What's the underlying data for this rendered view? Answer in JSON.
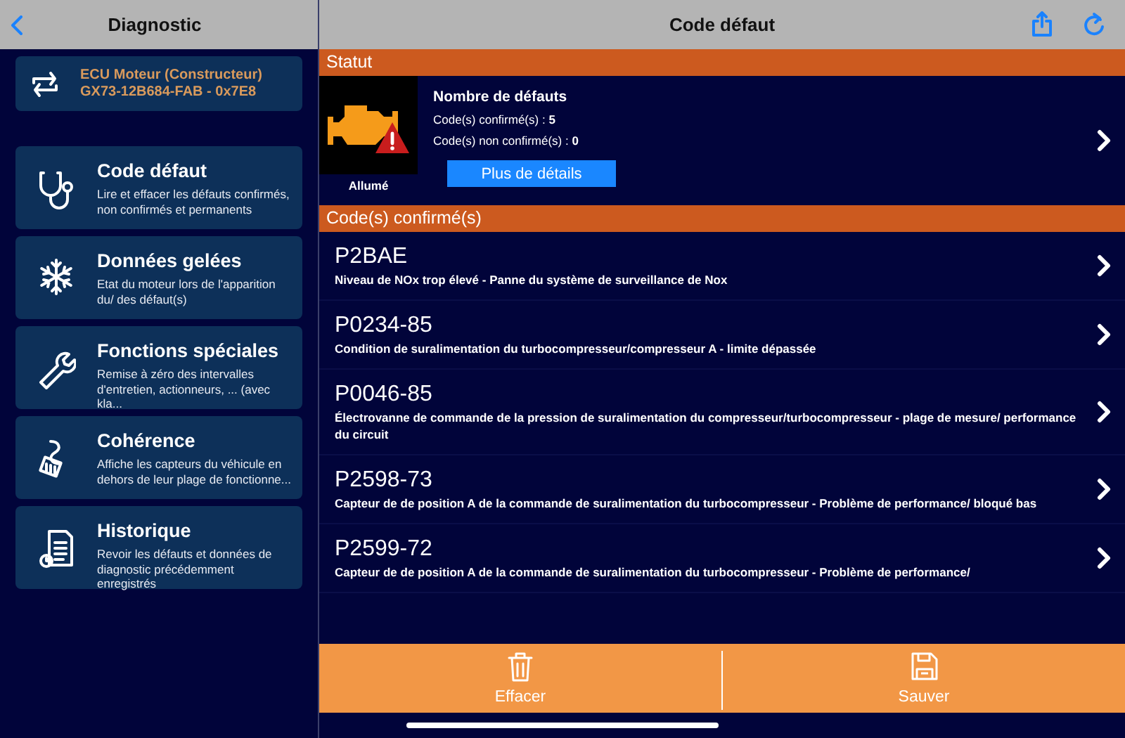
{
  "sidebar": {
    "title": "Diagnostic",
    "ecu": {
      "name": "ECU Moteur (Constructeur)",
      "reference": "GX73-12B684-FAB - 0x7E8"
    },
    "menu": [
      {
        "title": "Code défaut",
        "description": "Lire et effacer les défauts confirmés, non confirmés et permanents"
      },
      {
        "title": "Données gelées",
        "description": "Etat du moteur lors de l'apparition du/ des défaut(s)"
      },
      {
        "title": "Fonctions spéciales",
        "description": "Remise à zéro des intervalles d'entretien, actionneurs, ... (avec kla..."
      },
      {
        "title": "Cohérence",
        "description": "Affiche les capteurs du véhicule en dehors de leur plage de fonctionne..."
      },
      {
        "title": "Historique",
        "description": "Revoir les défauts et données de diagnostic précédemment enregistrés"
      }
    ]
  },
  "main": {
    "title": "Code défaut",
    "status": {
      "heading": "Statut",
      "lamp_label": "Allumé",
      "title": "Nombre de défauts",
      "counts": [
        {
          "label": "Code(s) confirmé(s) :",
          "value": "5"
        },
        {
          "label": "Code(s) non confirmé(s) :",
          "value": "0"
        }
      ],
      "button": "Plus de détails"
    },
    "confirmed": {
      "heading": "Code(s) confirmé(s)",
      "rows": [
        {
          "code": "P2BAE",
          "description": "Niveau de NOx trop élevé - Panne du système de surveillance de Nox"
        },
        {
          "code": "P0234-85",
          "description": "Condition de suralimentation du turbocompresseur/compresseur A - limite dépassée"
        },
        {
          "code": "P0046-85",
          "description": "Électrovanne de commande de la pression de suralimentation du compresseur/turbocompresseur - plage de mesure/ performance du circuit"
        },
        {
          "code": "P2598-73",
          "description": "Capteur de de position A de la commande de suralimentation du turbocompresseur - Problème de performance/ bloqué bas"
        },
        {
          "code": "P2599-72",
          "description": "Capteur de de position A de la commande de suralimentation du turbocompresseur - Problème de performance/"
        }
      ]
    },
    "footer": [
      {
        "label": "Effacer"
      },
      {
        "label": "Sauver"
      }
    ]
  }
}
